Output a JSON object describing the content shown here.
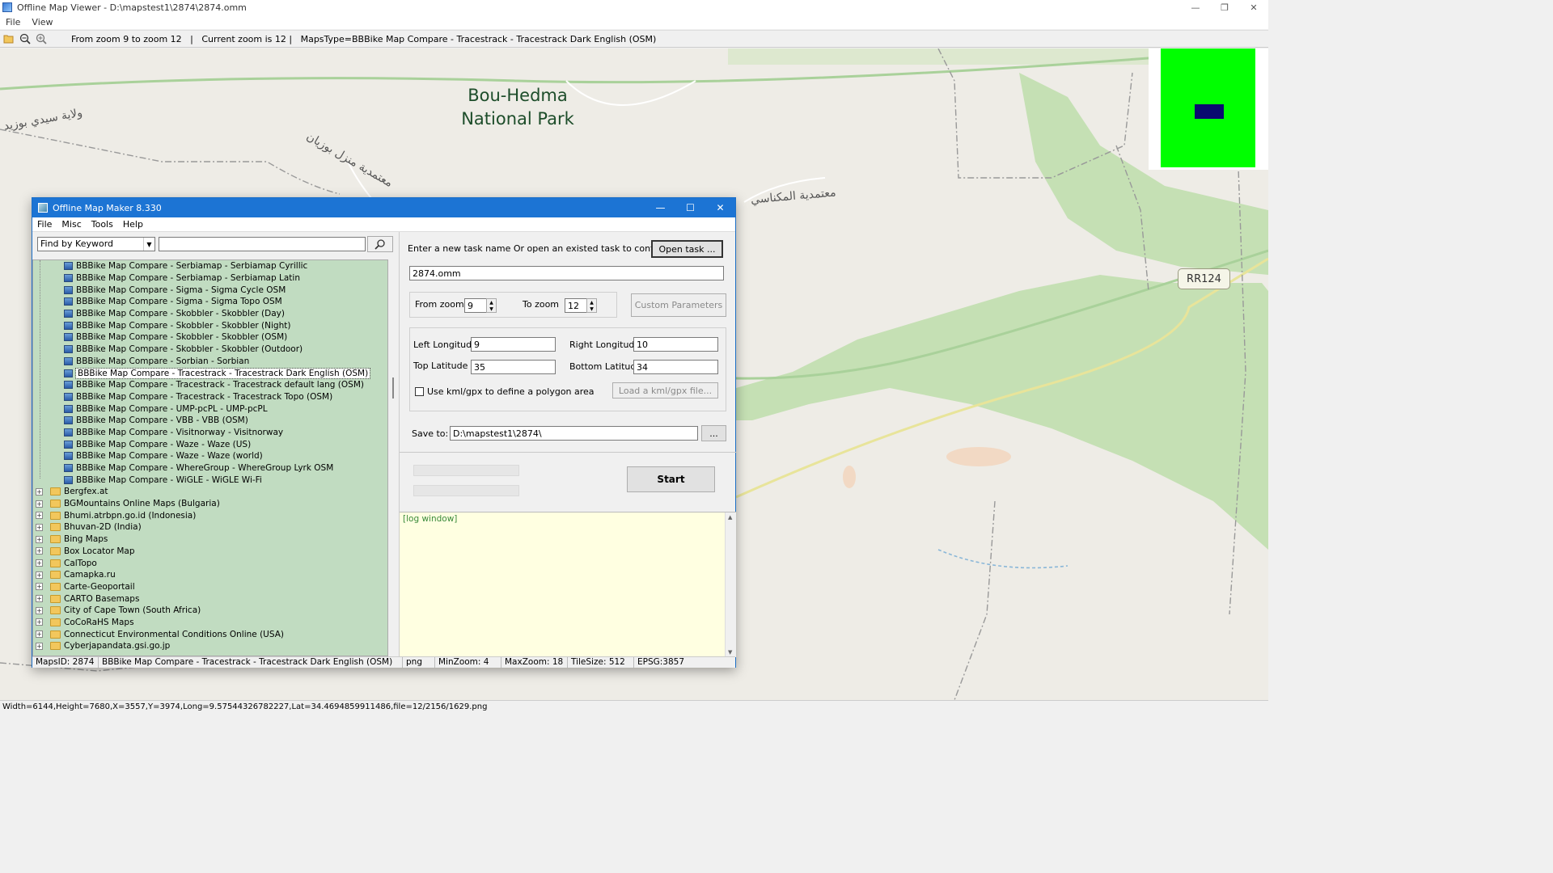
{
  "viewer": {
    "title": "Offline Map Viewer - D:\\mapstest1\\2874\\2874.omm",
    "menu": [
      "File",
      "View"
    ],
    "toolbar_info": "From zoom 9 to zoom 12   |   Current zoom is 12 |   MapsType=BBBike Map Compare - Tracestrack - Tracestrack Dark English (OSM)",
    "status": "Width=6144,Height=7680,X=3557,Y=3974,Long=9.57544326782227,Lat=34.4694859911486,file=12/2156/1629.png"
  },
  "map": {
    "park_line1": "Bou-Hedma",
    "park_line2": "National Park",
    "label_sidi_bouzid": "ولاية سيدي بوزيد",
    "label_menzel": "معتمدية منزل بوزيان",
    "label_maknassy": "معتمدية المكناسي",
    "road_shield": "RR124",
    "colors": {
      "land": "#eeece6",
      "park": "#c5e0b4",
      "overview": "#00ff00",
      "overview_rect": "#0a0a70"
    }
  },
  "dialog": {
    "title": "Offline Map Maker 8.330",
    "menu": [
      "File",
      "Misc",
      "Tools",
      "Help"
    ],
    "search_mode": "Find by Keyword",
    "search_value": "",
    "tree_children": [
      "BBBike Map Compare - Serbiamap - Serbiamap Cyrillic",
      "BBBike Map Compare - Serbiamap - Serbiamap Latin",
      "BBBike Map Compare - Sigma - Sigma Cycle OSM",
      "BBBike Map Compare - Sigma - Sigma Topo OSM",
      "BBBike Map Compare - Skobbler - Skobbler (Day)",
      "BBBike Map Compare - Skobbler - Skobbler (Night)",
      "BBBike Map Compare - Skobbler - Skobbler (OSM)",
      "BBBike Map Compare - Skobbler - Skobbler (Outdoor)",
      "BBBike Map Compare - Sorbian - Sorbian",
      "BBBike Map Compare - Tracestrack - Tracestrack Dark English (OSM)",
      "BBBike Map Compare - Tracestrack - Tracestrack default lang (OSM)",
      "BBBike Map Compare - Tracestrack - Tracestrack Topo (OSM)",
      "BBBike Map Compare - UMP-pcPL - UMP-pcPL",
      "BBBike Map Compare - VBB - VBB (OSM)",
      "BBBike Map Compare - Visitnorway - Visitnorway",
      "BBBike Map Compare - Waze - Waze (US)",
      "BBBike Map Compare - Waze - Waze (world)",
      "BBBike Map Compare - WhereGroup - WhereGroup Lyrk OSM",
      "BBBike Map Compare - WiGLE - WiGLE Wi-Fi"
    ],
    "tree_parents": [
      "Bergfex.at",
      "BGMountains Online Maps (Bulgaria)",
      "Bhumi.atrbpn.go.id (Indonesia)",
      "Bhuvan-2D (India)",
      "Bing Maps",
      "Box Locator Map",
      "CalTopo",
      "Camapka.ru",
      "Carte-Geoportail",
      "CARTO Basemaps",
      "City of Cape Town (South Africa)",
      "CoCoRaHS Maps",
      "Connecticut Environmental Conditions Online (USA)",
      "Cyberjapandata.gsi.go.jp"
    ],
    "task_label": "Enter a new task name Or open an existed task to continue:",
    "open_task": "Open task ...",
    "task_name": "2874.omm",
    "from_zoom_label": "From zoom",
    "from_zoom": "9",
    "to_zoom_label": "To zoom",
    "to_zoom": "12",
    "custom_params": "Custom Parameters",
    "left_lon_label": "Left Longitude",
    "left_lon": "9",
    "right_lon_label": "Right Longitude",
    "right_lon": "10",
    "top_lat_label": "Top Latitude",
    "top_lat": "35",
    "bottom_lat_label": "Bottom Latitude",
    "bottom_lat": "34",
    "kml_label": "Use kml/gpx to define a polygon area",
    "load_kml": "Load a kml/gpx file...",
    "save_to_label": "Save to:",
    "save_to": "D:\\mapstest1\\2874\\",
    "browse": "...",
    "start": "Start",
    "log_text": "[log window]",
    "status": {
      "maps_id": "MapsID: 2874",
      "maps_name": "BBBike Map Compare - Tracestrack - Tracestrack Dark English (OSM)",
      "format": "png",
      "min_zoom": "MinZoom: 4",
      "max_zoom": "MaxZoom: 18",
      "tile_size": "TileSize: 512",
      "epsg": "EPSG:3857"
    }
  }
}
